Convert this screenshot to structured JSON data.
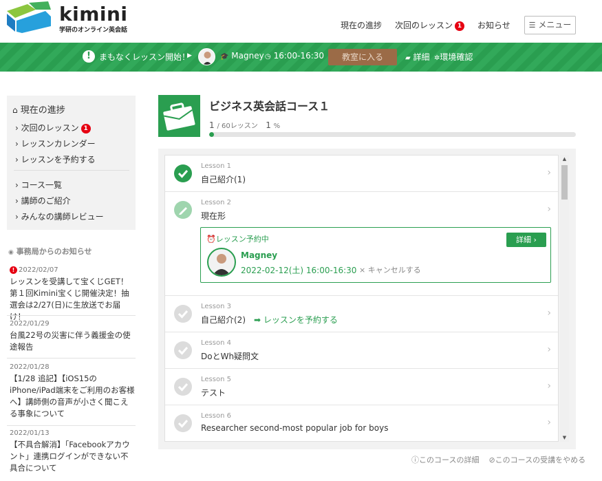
{
  "header": {
    "logo_text": "kimini",
    "logo_sub": "学研のオンライン英会話",
    "nav": [
      {
        "label": "現在の進捗"
      },
      {
        "label": "次回のレッスン",
        "badge": "1"
      },
      {
        "label": "お知らせ"
      }
    ],
    "menu_label": "メニュー"
  },
  "lesson_bar": {
    "alert_text": "まもなくレッスン開始！",
    "teacher": "Magney",
    "time": "16:00-16:30",
    "enter_button": "教室に入る",
    "detail_link": "詳細",
    "env_link": "環境確認"
  },
  "sidebar": {
    "heading": "現在の進捗",
    "items": [
      {
        "label": "次回のレッスン",
        "badge": "1"
      },
      {
        "label": "レッスンカレンダー"
      },
      {
        "label": "レッスンを予約する"
      },
      {
        "label": "コース一覧"
      },
      {
        "label": "講師のご紹介"
      },
      {
        "label": "みんなの講師レビュー"
      }
    ]
  },
  "news": {
    "heading": "事務局からのお知らせ",
    "items": [
      {
        "date": "2022/02/07",
        "title": "レッスンを受講して宝くじGET！第１回Kimini宝くじ開催決定！抽選会は2/27(日)に生放送でお届け！",
        "important": "!"
      },
      {
        "date": "2022/01/29",
        "title": "台風22号の災害に伴う義援金の使途報告"
      },
      {
        "date": "2022/01/28",
        "title": "【1/28 追記】【iOS15のiPhone/iPad端末をご利用のお客様へ】講師側の音声が小さく聞こえる事象について"
      },
      {
        "date": "2022/01/13",
        "title": "【不具合解消】「Facebookアカウント」連携ログインができない不具合について"
      }
    ]
  },
  "course": {
    "title": "ビジネス英会話コース１",
    "done": "1",
    "total": "/ 60レッスン",
    "percent_value": "1",
    "percent_unit": "%",
    "progress": 0.01
  },
  "lessons": [
    {
      "num": "Lesson 1",
      "name": "自己紹介(1)",
      "status": "done"
    },
    {
      "num": "Lesson 2",
      "name": "現在形",
      "status": "current"
    },
    {
      "num": "Lesson 3",
      "name": "自己紹介(2)",
      "status": "todo",
      "reserve": "レッスンを予約する"
    },
    {
      "num": "Lesson 4",
      "name": "DoとWh疑問文",
      "status": "todo"
    },
    {
      "num": "Lesson 5",
      "name": "テスト",
      "status": "todo"
    },
    {
      "num": "Lesson 6",
      "name": "Researcher second-most popular job for boys",
      "status": "todo"
    }
  ],
  "booking": {
    "label": "レッスン予約中",
    "detail_button": "詳細",
    "teacher": "Magney",
    "datetime": "2022-02-12(土) 16:00-16:30",
    "cancel": "キャンセルする"
  },
  "footer": {
    "course_detail": "このコースの詳細",
    "quit_course": "このコースの受講をやめる"
  },
  "colors": {
    "brand_green": "#2a9e50",
    "badge_red": "#e60012",
    "enter_brown": "#9b6b47"
  }
}
